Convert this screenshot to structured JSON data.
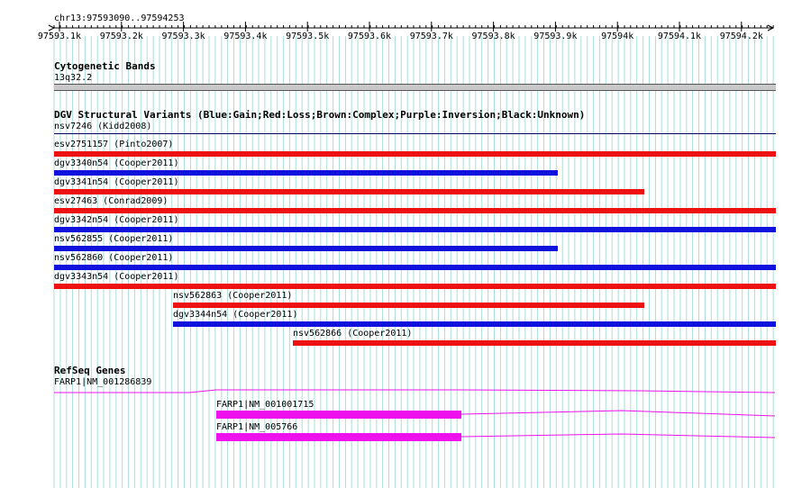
{
  "colors": {
    "gain": "#1111dd",
    "loss": "#ee1111",
    "gene": "#ee11ee",
    "grid": "#aadddd",
    "axis": "#000000"
  },
  "ruler": {
    "location": "chr13:97593090..97594253",
    "ticks": [
      "97593.1k",
      "97593.2k",
      "97593.3k",
      "97593.4k",
      "97593.5k",
      "97593.6k",
      "97593.7k",
      "97593.8k",
      "97593.9k",
      "97594k",
      "97594.1k",
      "97594.2k"
    ]
  },
  "cytoband": {
    "title": "Cytogenetic Bands",
    "band": "13q32.2"
  },
  "dgv": {
    "title": "DGV Structural Variants (Blue:Gain;Red:Loss;Brown:Complex;Purple:Inversion;Black:Unknown)",
    "variants": [
      {
        "label": "nsv7246 (Kidd2008)",
        "type": "unknown"
      },
      {
        "label": "esv2751157 (Pinto2007)",
        "type": "loss"
      },
      {
        "label": "dgv3340n54 (Cooper2011)",
        "type": "gain"
      },
      {
        "label": "dgv3341n54 (Cooper2011)",
        "type": "loss"
      },
      {
        "label": "esv27463 (Conrad2009)",
        "type": "loss"
      },
      {
        "label": "dgv3342n54 (Cooper2011)",
        "type": "gain"
      },
      {
        "label": "nsv562855 (Cooper2011)",
        "type": "gain"
      },
      {
        "label": "nsv562860 (Cooper2011)",
        "type": "gain"
      },
      {
        "label": "dgv3343n54 (Cooper2011)",
        "type": "loss"
      },
      {
        "label": "nsv562863 (Cooper2011)",
        "type": "loss"
      },
      {
        "label": "dgv3344n54 (Cooper2011)",
        "type": "gain"
      },
      {
        "label": "nsv562866 (Cooper2011)",
        "type": "loss"
      }
    ]
  },
  "refseq": {
    "title": "RefSeq Genes",
    "genes": [
      {
        "label": "FARP1|NM_001286839"
      },
      {
        "label": "FARP1|NM_001001715"
      },
      {
        "label": "FARP1|NM_005766"
      }
    ]
  }
}
